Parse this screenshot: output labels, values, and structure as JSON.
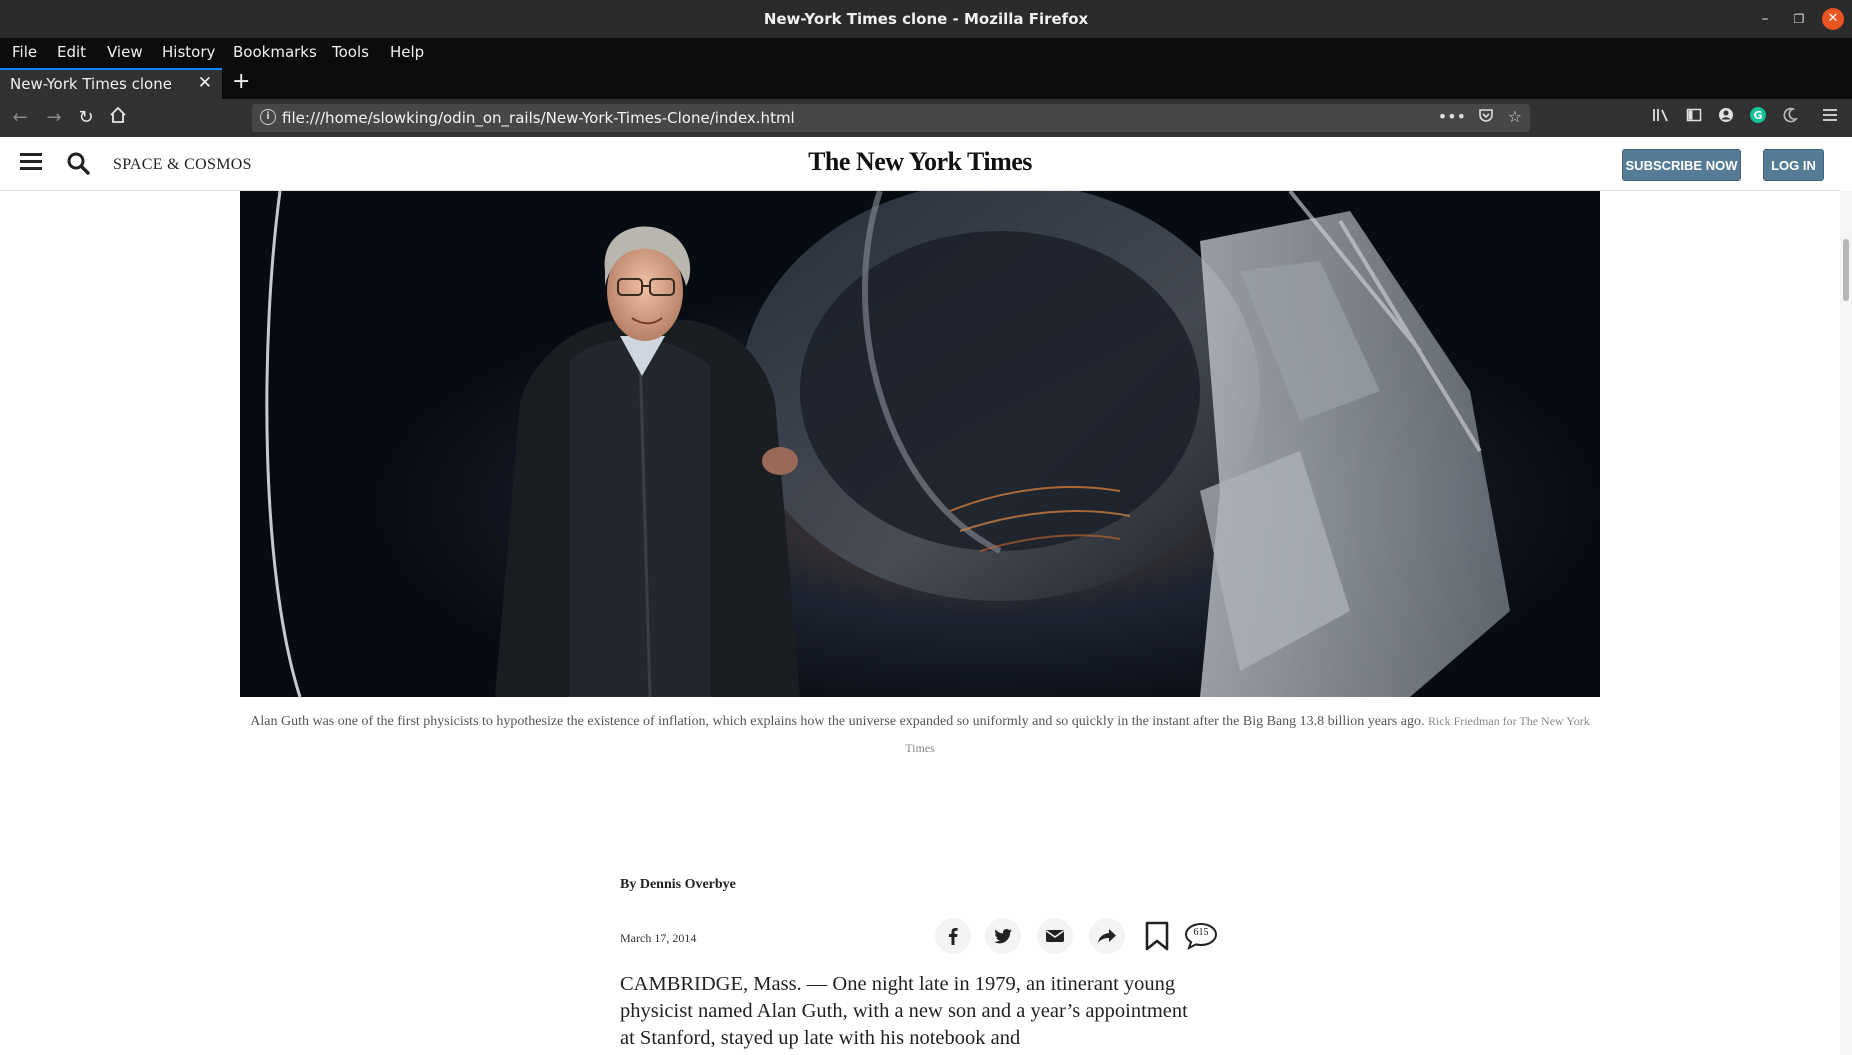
{
  "window": {
    "title": "New-York Times clone - Mozilla Firefox"
  },
  "menu": {
    "items": [
      "File",
      "Edit",
      "View",
      "History",
      "Bookmarks",
      "Tools",
      "Help"
    ]
  },
  "tab": {
    "label": "New-York Times clone"
  },
  "address_bar": {
    "url": "file:///home/slowking/odin_on_rails/New-York-Times-Clone/index.html"
  },
  "header": {
    "section": "SPACE & COSMOS",
    "masthead": "The New York Times",
    "subscribe_label": "SUBSCRIBE NOW",
    "login_label": "LOG IN"
  },
  "article": {
    "caption": "Alan Guth was one of the first physicists to hypothesize the existence of inflation, which explains how the universe expanded so uniformly and so quickly in the instant after the Big Bang 13.8 billion years ago.",
    "credit": "Rick Friedman for The New York Times",
    "byline": "By Dennis Overbye",
    "date": "March 17, 2014",
    "comment_count": "615",
    "body": "CAMBRIDGE, Mass. — One night late in 1979, an itinerant young physicist named Alan Guth, with a new son and a year’s appointment at Stanford, stayed up late with his notebook and"
  }
}
